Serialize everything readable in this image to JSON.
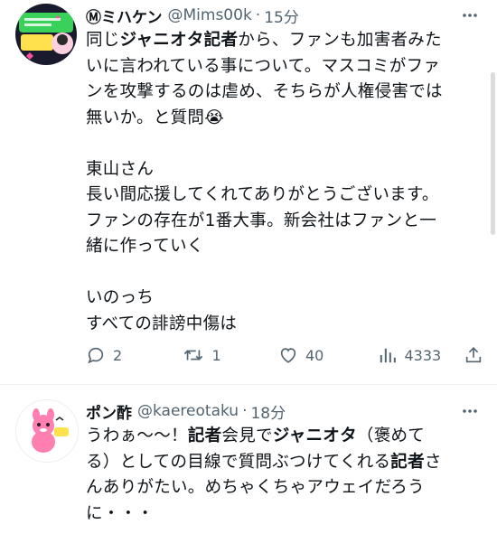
{
  "tweets": [
    {
      "name": "Ⓜミハケン",
      "handle": "@Mims00k",
      "dot": "·",
      "time": "15分",
      "lines": [
        "同じ<b>ジャニオタ記者</b>から、ファンも加害者みた",
        "いに言われている事について。マスコミがファ",
        "ンを攻撃するのは虐め、そちらが人権侵害では",
        "無いか。と質問😭",
        "",
        "東山さん",
        "長い間応援してくれてありがとうございます。",
        "ファンの存在が1番大事。新会社はファンと一",
        "緒に作っていく",
        "",
        "いのっち",
        "すべての誹謗中傷は"
      ],
      "replies": "2",
      "retweets": "1",
      "likes": "40",
      "views": "4333"
    },
    {
      "name": "ポン酢",
      "handle": "@kaereotaku",
      "dot": "·",
      "time": "18分",
      "lines": [
        "うわぁ〜〜！<b>記者</b>会見で<b>ジャニオタ</b>（褒めて",
        "る）としての目線で質問ぶつけてくれる<b>記者</b>さ",
        "んありがたい。めちゃくちゃアウェイだろう",
        "に・・・"
      ]
    }
  ],
  "colors": {
    "text": "#0f1419",
    "secondary": "#536471",
    "avatar1_bg": "#1a1a2e",
    "avatar1_green": "#3ad15a",
    "avatar1_pink": "#ff4fa0",
    "avatar2_pink": "#ff7fb0"
  }
}
